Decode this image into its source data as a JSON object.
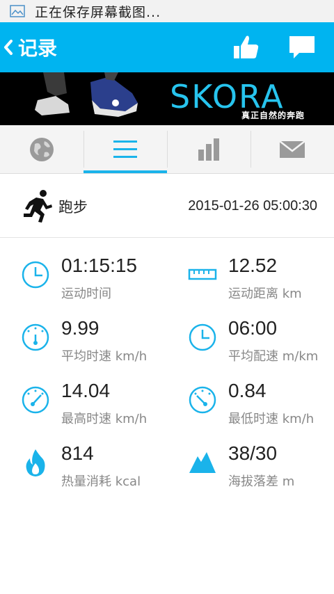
{
  "status_bar": {
    "text": "正在保存屏幕截图..."
  },
  "header": {
    "title": "记录"
  },
  "banner": {
    "brand": "SKORA",
    "slogan": "真正自然的奔跑"
  },
  "tabs": [
    "globe-icon",
    "list-icon",
    "bar-chart-icon",
    "mail-icon"
  ],
  "activity": {
    "name": "跑步",
    "datetime": "2015-01-26 05:00:30"
  },
  "stats": [
    {
      "value": "01:15:15",
      "label": "运动时间",
      "icon": "clock-icon"
    },
    {
      "value": "12.52",
      "label": "运动距离 km",
      "icon": "ruler-icon"
    },
    {
      "value": "9.99",
      "label": "平均时速 km/h",
      "icon": "speedometer-icon"
    },
    {
      "value": "06:00",
      "label": "平均配速 m/km",
      "icon": "clock-icon"
    },
    {
      "value": "14.04",
      "label": "最高时速 km/h",
      "icon": "speedometer-icon"
    },
    {
      "value": "0.84",
      "label": "最低时速 km/h",
      "icon": "speedometer-icon"
    },
    {
      "value": "814",
      "label": "热量消耗 kcal",
      "icon": "flame-icon"
    },
    {
      "value": "38/30",
      "label": "海拔落差 m",
      "icon": "mountain-icon"
    }
  ],
  "colors": {
    "accent": "#00b4f0",
    "icon": "#1ab3ea"
  }
}
